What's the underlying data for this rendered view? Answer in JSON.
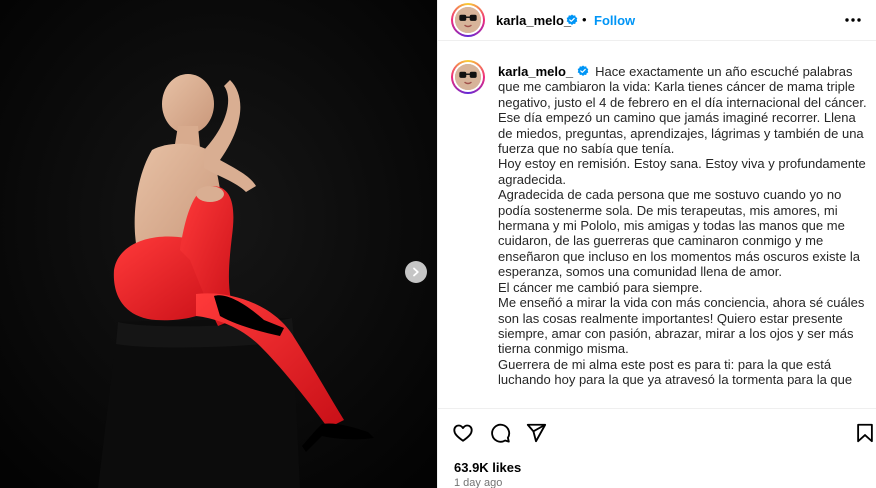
{
  "post": {
    "username": "karla_melo_",
    "follow_label": "Follow",
    "separator": "•",
    "caption_lines": [
      "Hace exactamente un año escuché palabras que me cambiaron la vida: Karla tienes cáncer de mama triple negativo, justo el 4 de febrero en el día internacional del cáncer. Ese día empezó un camino que jamás imaginé recorrer. Llena de miedos, preguntas, aprendizajes, lágrimas y también de una fuerza que no sabía que tenía.",
      "Hoy estoy en remisión. Estoy sana. Estoy viva y profundamente agradecida.",
      "Agradecida de cada persona que me sostuvo cuando yo no podía sostenerme sola. De mis terapeutas, mis amores, mi hermana y mi Pololo, mis amigas y todas las manos que me cuidaron, de las guerreras que caminaron conmigo y me enseñaron que incluso en los momentos más oscuros existe la esperanza, somos una comunidad llena de amor.",
      "El cáncer me cambió para siempre.",
      "Me enseñó a mirar la vida con más conciencia, ahora sé cuáles son las cosas realmente importantes! Quiero estar presente siempre, amar con pasión, abrazar, mirar a los ojos y ser más tierna conmigo misma.",
      "Guerrera de mi alma este post es para ti: para la que está luchando hoy para la que ya atravesó la tormenta para la que"
    ],
    "likes": "63.9K likes",
    "time_ago": "1 day ago"
  },
  "icons": {
    "next": "chevron-right-icon",
    "more": "more-options-icon",
    "like": "heart-icon",
    "comment": "comment-icon",
    "share": "share-icon",
    "save": "bookmark-icon",
    "verified": "verified-badge-icon"
  },
  "colors": {
    "follow": "#0095f6",
    "verified": "#0095f6",
    "media_bg": "#050505",
    "tights": "#ec1c24"
  }
}
